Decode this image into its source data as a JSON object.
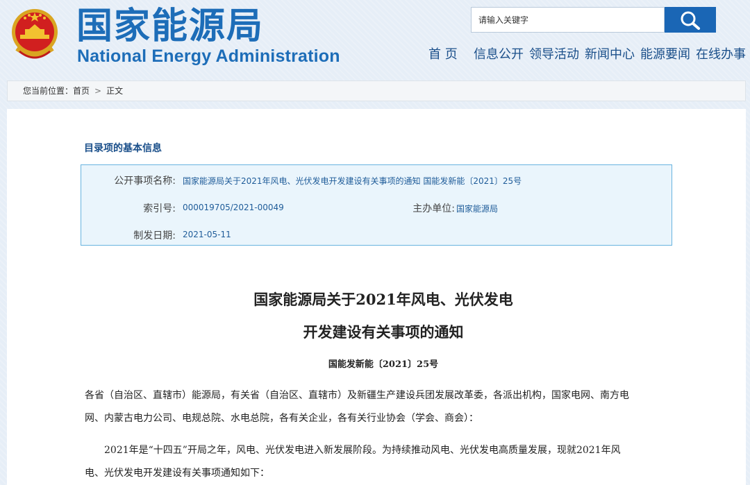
{
  "header": {
    "logo_cn": "国家能源局",
    "logo_en": "National Energy Administration",
    "search": {
      "placeholder": "请输入关键字"
    },
    "nav": [
      "首 页",
      "信息公开",
      "领导活动",
      "新闻中心",
      "能源要闻",
      "在线办事"
    ]
  },
  "breadcrumb": {
    "prefix": "您当前位置：",
    "home": "首页",
    "separator": ">",
    "current": "正文"
  },
  "info": {
    "title": "目录项的基本信息",
    "rows": {
      "name_label": "公开事项名称:",
      "name_value": "国家能源局关于2021年风电、光伏发电开发建设有关事项的通知 国能发新能〔2021〕25号",
      "index_label": "索引号:",
      "index_value": "000019705/2021-00049",
      "org_label": "主办单位:",
      "org_value": "国家能源局",
      "date_label": "制发日期:",
      "date_value": "2021-05-11"
    }
  },
  "document": {
    "title_line1": "国家能源局关于2021年风电、光伏发电",
    "title_line2": "开发建设有关事项的通知",
    "number": "国能发新能〔2021〕25号",
    "para1_line1": "各省（自治区、直辖市）能源局，有关省（自治区、直辖市）及新疆生产建设兵团发展改革委，各派出机构，国家电网、南方电",
    "para1_line2": "网、内蒙古电力公司、电规总院、水电总院，各有关企业，各有关行业协会（学会、商会）：",
    "para2_line1": "2021年是“十四五”开局之年，风电、光伏发电进入新发展阶段。为持续推动风电、光伏发电高质量发展，现就2021年风",
    "para2_line2": "电、光伏发电开发建设有关事项通知如下："
  },
  "colors": {
    "brand_blue": "#1d6db8",
    "search_button": "#1a66b5",
    "info_border": "#68b3df",
    "info_bg": "#eaf5fc"
  },
  "icons": {
    "emblem": "national-emblem-icon",
    "search": "magnifier-icon"
  }
}
